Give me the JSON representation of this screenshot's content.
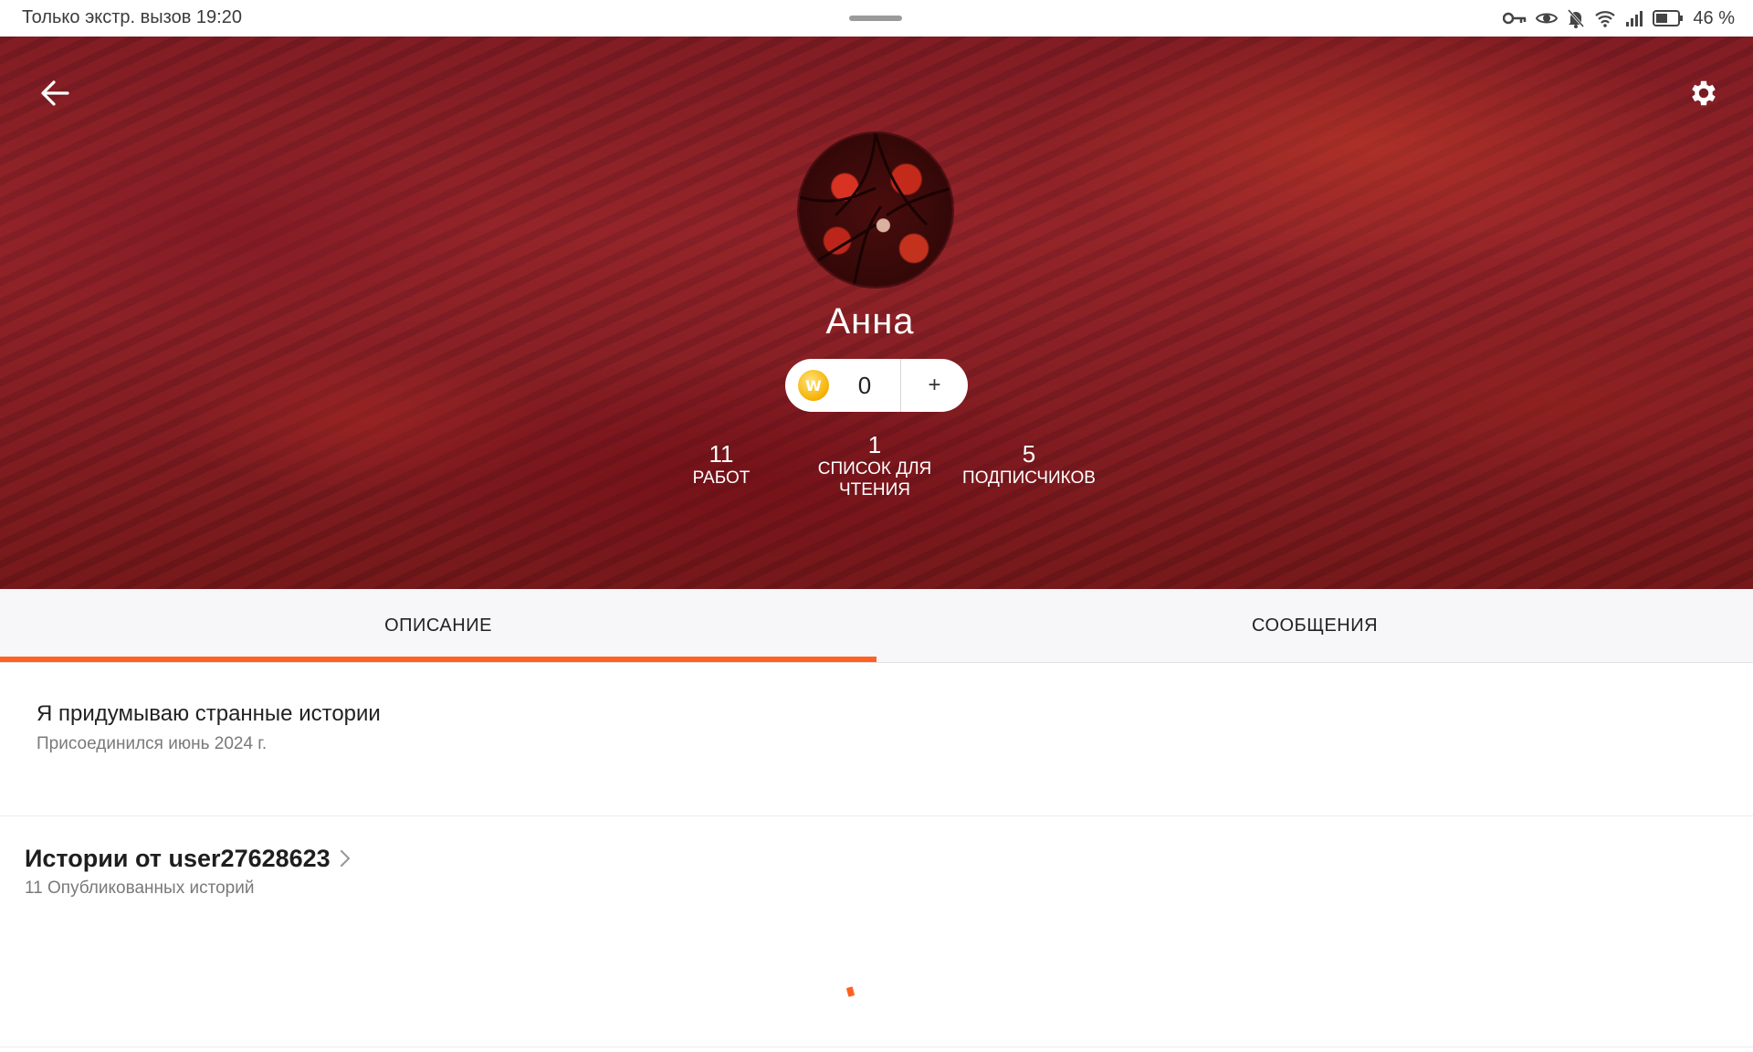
{
  "status_bar": {
    "left_text": "Только экстр. вызов 19:20",
    "battery_text": "46 %",
    "icons": [
      "key-icon",
      "eye-icon",
      "bell-off-icon",
      "wifi-icon",
      "signal-icon",
      "battery-icon"
    ]
  },
  "header": {
    "back_icon": "arrow-left-icon",
    "settings_icon": "gear-icon",
    "username": "Анна",
    "coins": {
      "icon": "coin-icon",
      "coin_letter": "W",
      "count": "0",
      "add_label": "+"
    },
    "stats": [
      {
        "num": "11",
        "label": "РАБОТ"
      },
      {
        "num": "1",
        "label_line1": "СПИСОК ДЛЯ",
        "label_line2": "ЧТЕНИЯ"
      },
      {
        "num": "5",
        "label": "ПОДПИСЧИКОВ"
      }
    ]
  },
  "tabs": [
    {
      "label": "ОПИСАНИЕ",
      "active": true
    },
    {
      "label": "СООБЩЕНИЯ",
      "active": false
    }
  ],
  "about": {
    "description": "Я придумываю странные истории",
    "joined": "Присоединился июнь 2024 г."
  },
  "stories": {
    "title": "Истории от user27628623",
    "count_text": "11 Опубликованных историй"
  },
  "colors": {
    "accent": "#ff6122",
    "header_bg": "#7c1b21",
    "tab_bg": "#f7f6f8"
  }
}
